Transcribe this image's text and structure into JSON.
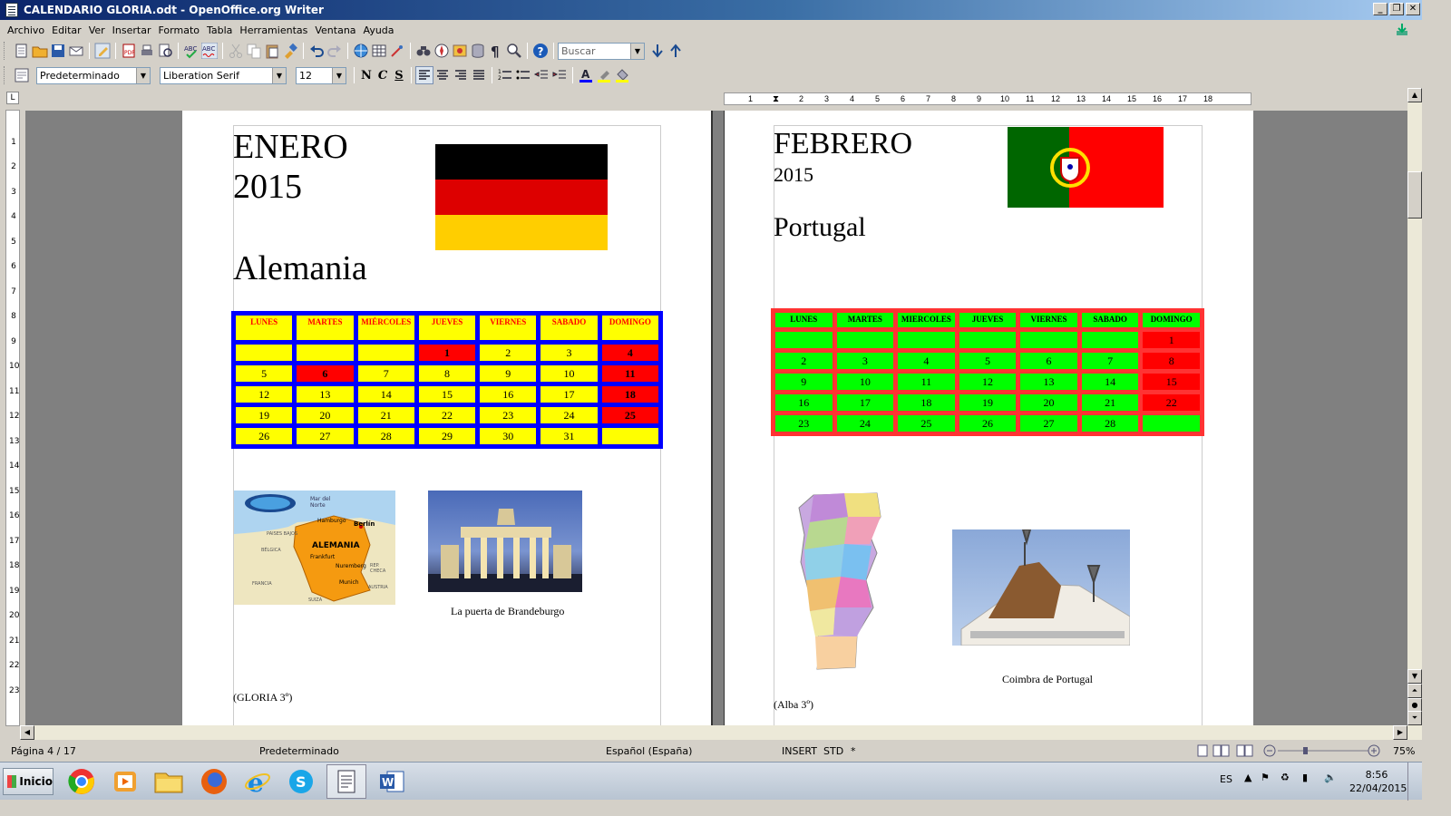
{
  "window": {
    "title": "CALENDARIO GLORIA.odt - OpenOffice.org Writer"
  },
  "menu": [
    "Archivo",
    "Editar",
    "Ver",
    "Insertar",
    "Formato",
    "Tabla",
    "Herramientas",
    "Ventana",
    "Ayuda"
  ],
  "toolbar": {
    "search_placeholder": "Buscar",
    "style": "Predeterminado",
    "font": "Liberation Serif",
    "size": "12",
    "bold": "N",
    "italic": "C",
    "underline": "S"
  },
  "ruler": {
    "h_ticks": [
      "1",
      "2",
      "3",
      "4",
      "5",
      "6",
      "7",
      "8",
      "9",
      "10",
      "11",
      "12",
      "13",
      "14",
      "15",
      "16",
      "17",
      "18"
    ],
    "v_ticks": [
      "1",
      "2",
      "3",
      "4",
      "5",
      "6",
      "7",
      "8",
      "9",
      "10",
      "11",
      "12",
      "13",
      "14",
      "15",
      "16",
      "17",
      "18",
      "19",
      "20",
      "21",
      "22",
      "23"
    ]
  },
  "page1": {
    "month": "ENERO",
    "year": "2015",
    "country": "Alemania",
    "days": [
      "LUNES",
      "MARTES",
      "MIÉRCOLES",
      "JUEVES",
      "VIERNES",
      "SABADO",
      "DOMINGO"
    ],
    "weeks": [
      [
        "",
        "",
        "",
        "1",
        "2",
        "3",
        "4"
      ],
      [
        "5",
        "6",
        "7",
        "8",
        "9",
        "10",
        "11"
      ],
      [
        "12",
        "13",
        "14",
        "15",
        "16",
        "17",
        "18"
      ],
      [
        "19",
        "20",
        "21",
        "22",
        "23",
        "24",
        "25"
      ],
      [
        "26",
        "27",
        "28",
        "29",
        "30",
        "31",
        ""
      ]
    ],
    "map": {
      "sea": "Mar del Norte",
      "country": "ALEMANIA",
      "cities": [
        "Hamburgo",
        "Berlín",
        "Frankfurt",
        "Nuremberg",
        "Munich"
      ],
      "neighbors": [
        "PAISES BAJOS",
        "BÉLGICA",
        "FRANCIA",
        "SUIZA",
        "AUSTRIA",
        "REP. CHECA"
      ]
    },
    "caption": "La puerta de Brandeburgo",
    "author": "(GLORIA 3º)"
  },
  "page2": {
    "month": "FEBRERO",
    "year": "2015",
    "country": "Portugal",
    "days": [
      "LUNES",
      "MARTES",
      "MIERCOLES",
      "JUEVES",
      "VIERNES",
      "SABADO",
      "DOMINGO"
    ],
    "weeks": [
      [
        "",
        "",
        "",
        "",
        "",
        "",
        "1"
      ],
      [
        "2",
        "3",
        "4",
        "5",
        "6",
        "7",
        "8"
      ],
      [
        "9",
        "10",
        "11",
        "12",
        "13",
        "14",
        "15"
      ],
      [
        "16",
        "17",
        "18",
        "19",
        "20",
        "21",
        "22"
      ],
      [
        "23",
        "24",
        "25",
        "26",
        "27",
        "28",
        ""
      ]
    ],
    "caption": "Coimbra de Portugal",
    "author": "(Alba 3º)"
  },
  "status": {
    "page": "Página  4 / 17",
    "style": "Predeterminado",
    "language": "Español (España)",
    "mode": "INSERT",
    "selection": "STD",
    "modified": "*",
    "zoom": "75%"
  },
  "taskbar": {
    "start": "Inicio",
    "lang": "ES",
    "time": "8:56",
    "date": "22/04/2015"
  },
  "colors": {
    "jan_table_border": "#0000ff",
    "jan_cell": "#ffff00",
    "jan_text": "#ff0000",
    "jan_holiday": "#ff0000",
    "feb_table_border": "#ff3333",
    "feb_cell": "#00ff00",
    "feb_holiday": "#ff0000",
    "flag_de": [
      "#000000",
      "#dd0000",
      "#ffce00"
    ],
    "flag_pt": [
      "#006600",
      "#ff0000"
    ]
  }
}
